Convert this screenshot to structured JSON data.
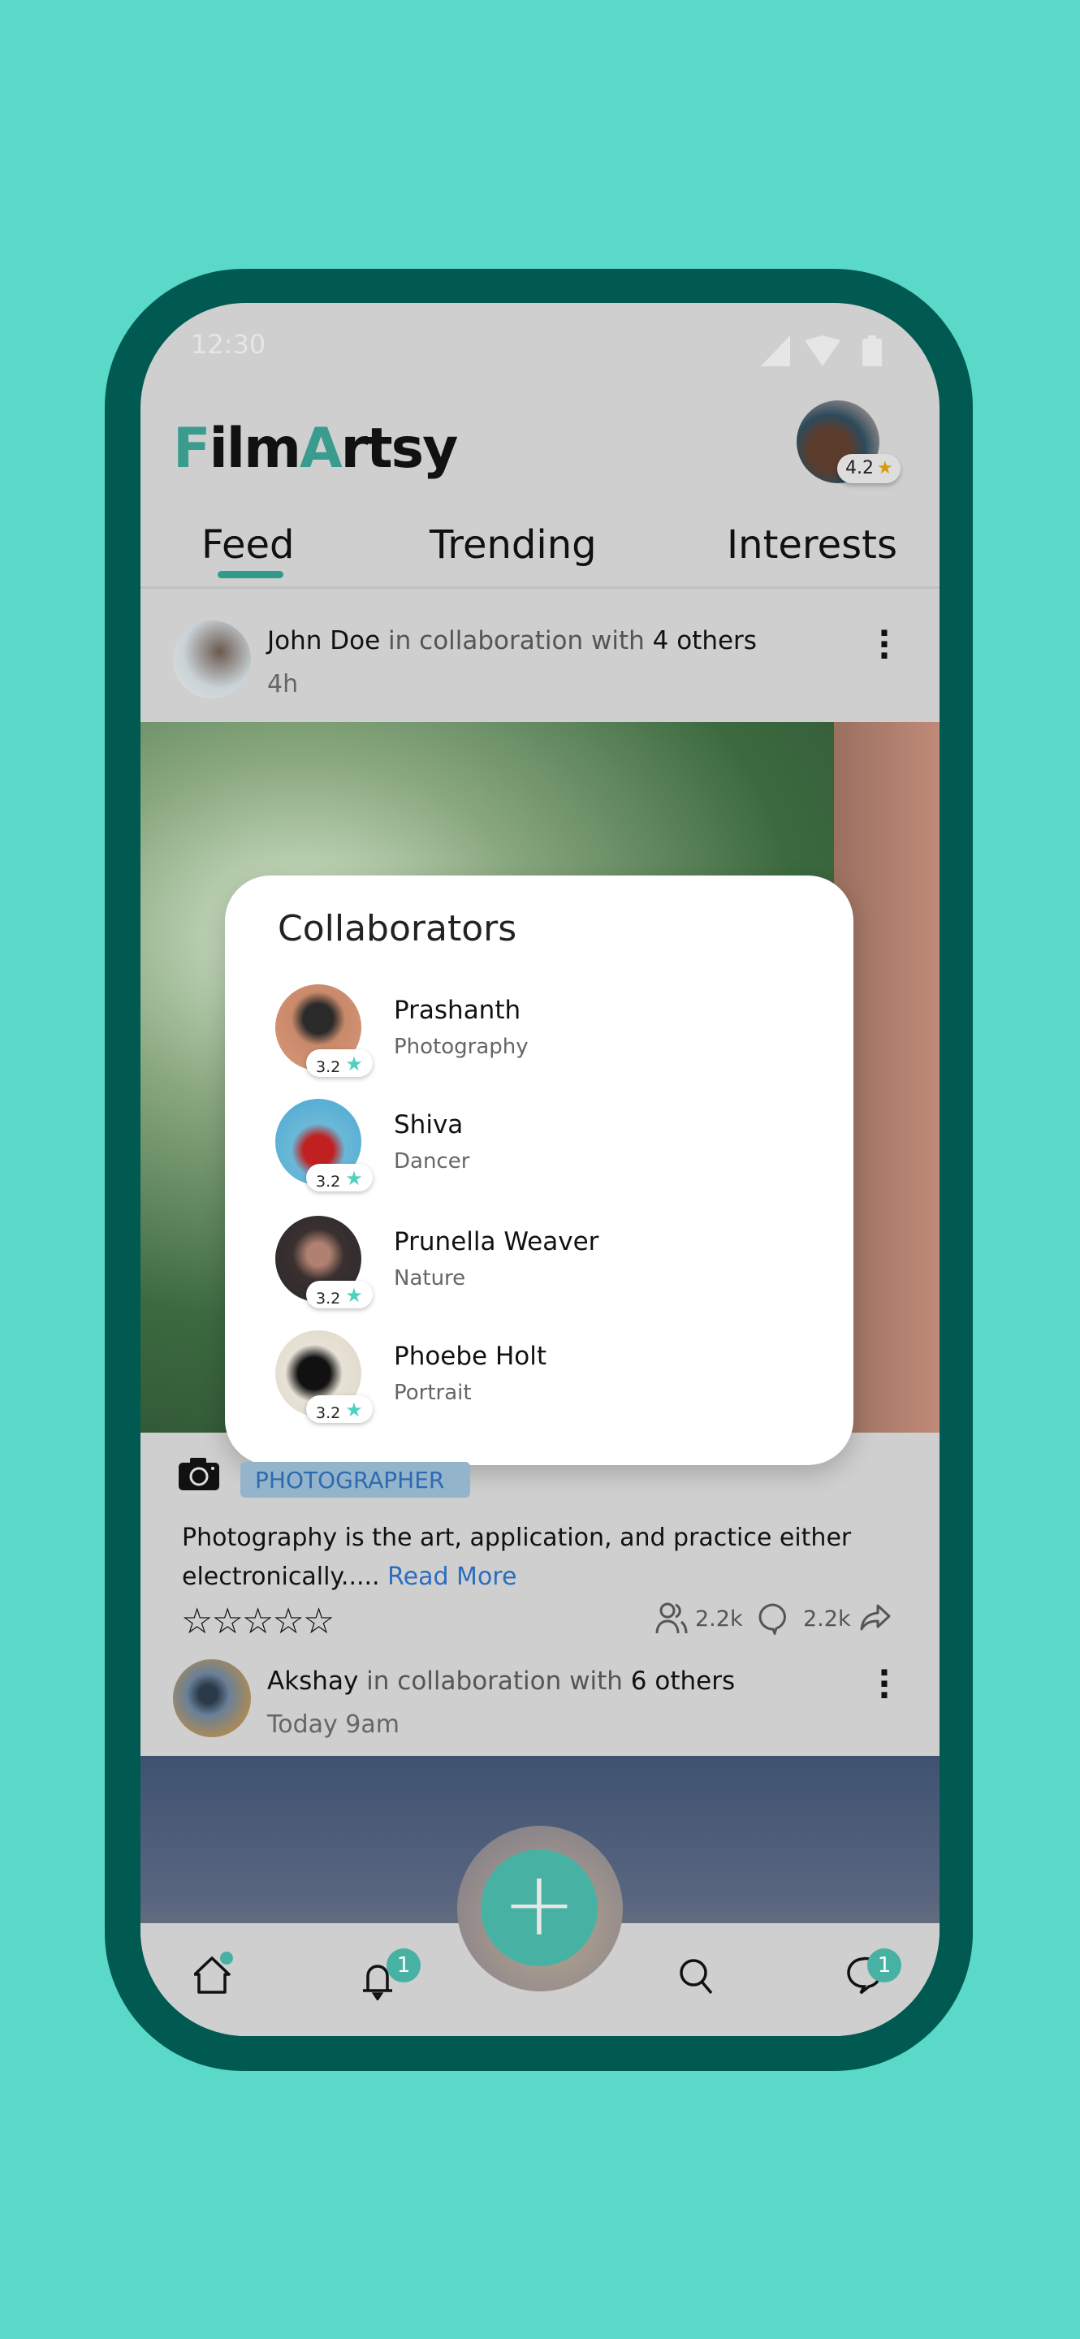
{
  "status_bar": {
    "time": "12:30"
  },
  "header": {
    "logo": "FilmArtsy",
    "logo_parts": [
      "F",
      "ilm",
      "A",
      "rtsy"
    ],
    "profile_rating": "4.2"
  },
  "tabs": [
    {
      "label": "Feed",
      "active": true
    },
    {
      "label": "Trending"
    },
    {
      "label": "Interests"
    }
  ],
  "posts": [
    {
      "author": "John Doe",
      "collab_text": "in collaboration with",
      "others": "4 others",
      "time": "4h",
      "category": "PHOTOGRAPHER",
      "description": "Photography is the art, application, and practice either electronically.....",
      "read_more": "Read More",
      "rating": 0,
      "followers": "2.2k",
      "comments": "2.2k"
    },
    {
      "author": "Akshay",
      "collab_text": "in collaboration with",
      "others": "6 others",
      "time": "Today 9am"
    }
  ],
  "modal": {
    "title": "Collaborators",
    "items": [
      {
        "name": "Prashanth",
        "role": "Photography",
        "rating": "3.2"
      },
      {
        "name": "Shiva",
        "role": "Dancer",
        "rating": "3.2"
      },
      {
        "name": "Prunella Weaver",
        "role": "Nature",
        "rating": "3.2"
      },
      {
        "name": "Phoebe Holt",
        "role": "Portrait",
        "rating": "3.2"
      }
    ]
  },
  "nav": {
    "notifications_count": "1",
    "messages_count": "1",
    "items": [
      "home-icon",
      "bell-icon",
      "plus-icon",
      "search-icon",
      "chat-icon"
    ]
  },
  "colors": {
    "background": "#5ad8c8",
    "frame": "#005a52",
    "accent": "#47b2a3",
    "link": "#2a6ec0"
  }
}
